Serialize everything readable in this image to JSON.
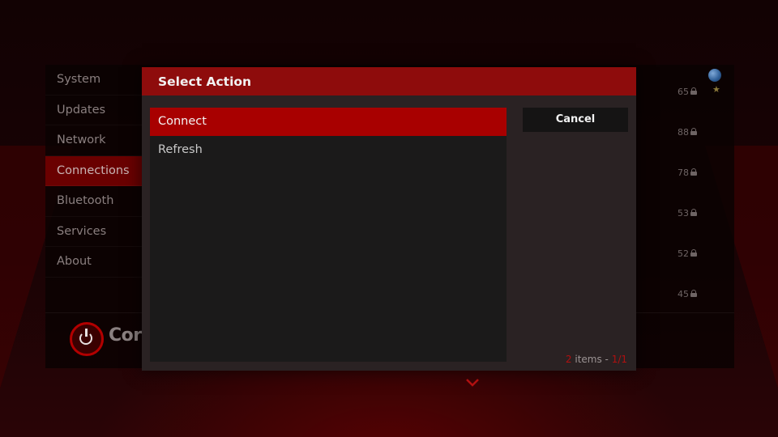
{
  "settings_menu": {
    "items": [
      {
        "label": "System"
      },
      {
        "label": "Updates"
      },
      {
        "label": "Network"
      },
      {
        "label": "Connections"
      },
      {
        "label": "Bluetooth"
      },
      {
        "label": "Services"
      },
      {
        "label": "About"
      }
    ],
    "active_index": 3
  },
  "connections": [
    {
      "strength": "65"
    },
    {
      "strength": "88"
    },
    {
      "strength": "78"
    },
    {
      "strength": "53"
    },
    {
      "strength": "52"
    },
    {
      "strength": "45"
    }
  ],
  "brand": {
    "logo_text": "Core"
  },
  "dialog": {
    "title": "Select Action",
    "options": [
      {
        "label": "Connect"
      },
      {
        "label": "Refresh"
      }
    ],
    "cancel_label": "Cancel",
    "footer": {
      "count": "2",
      "items_text": " items - ",
      "page": "1/1"
    }
  },
  "colors": {
    "accent": "#a80000",
    "header": "#8e0c0c"
  },
  "icons": [
    "lock-icon",
    "globe-icon",
    "star-icon",
    "power-icon",
    "chevron-down-icon"
  ]
}
